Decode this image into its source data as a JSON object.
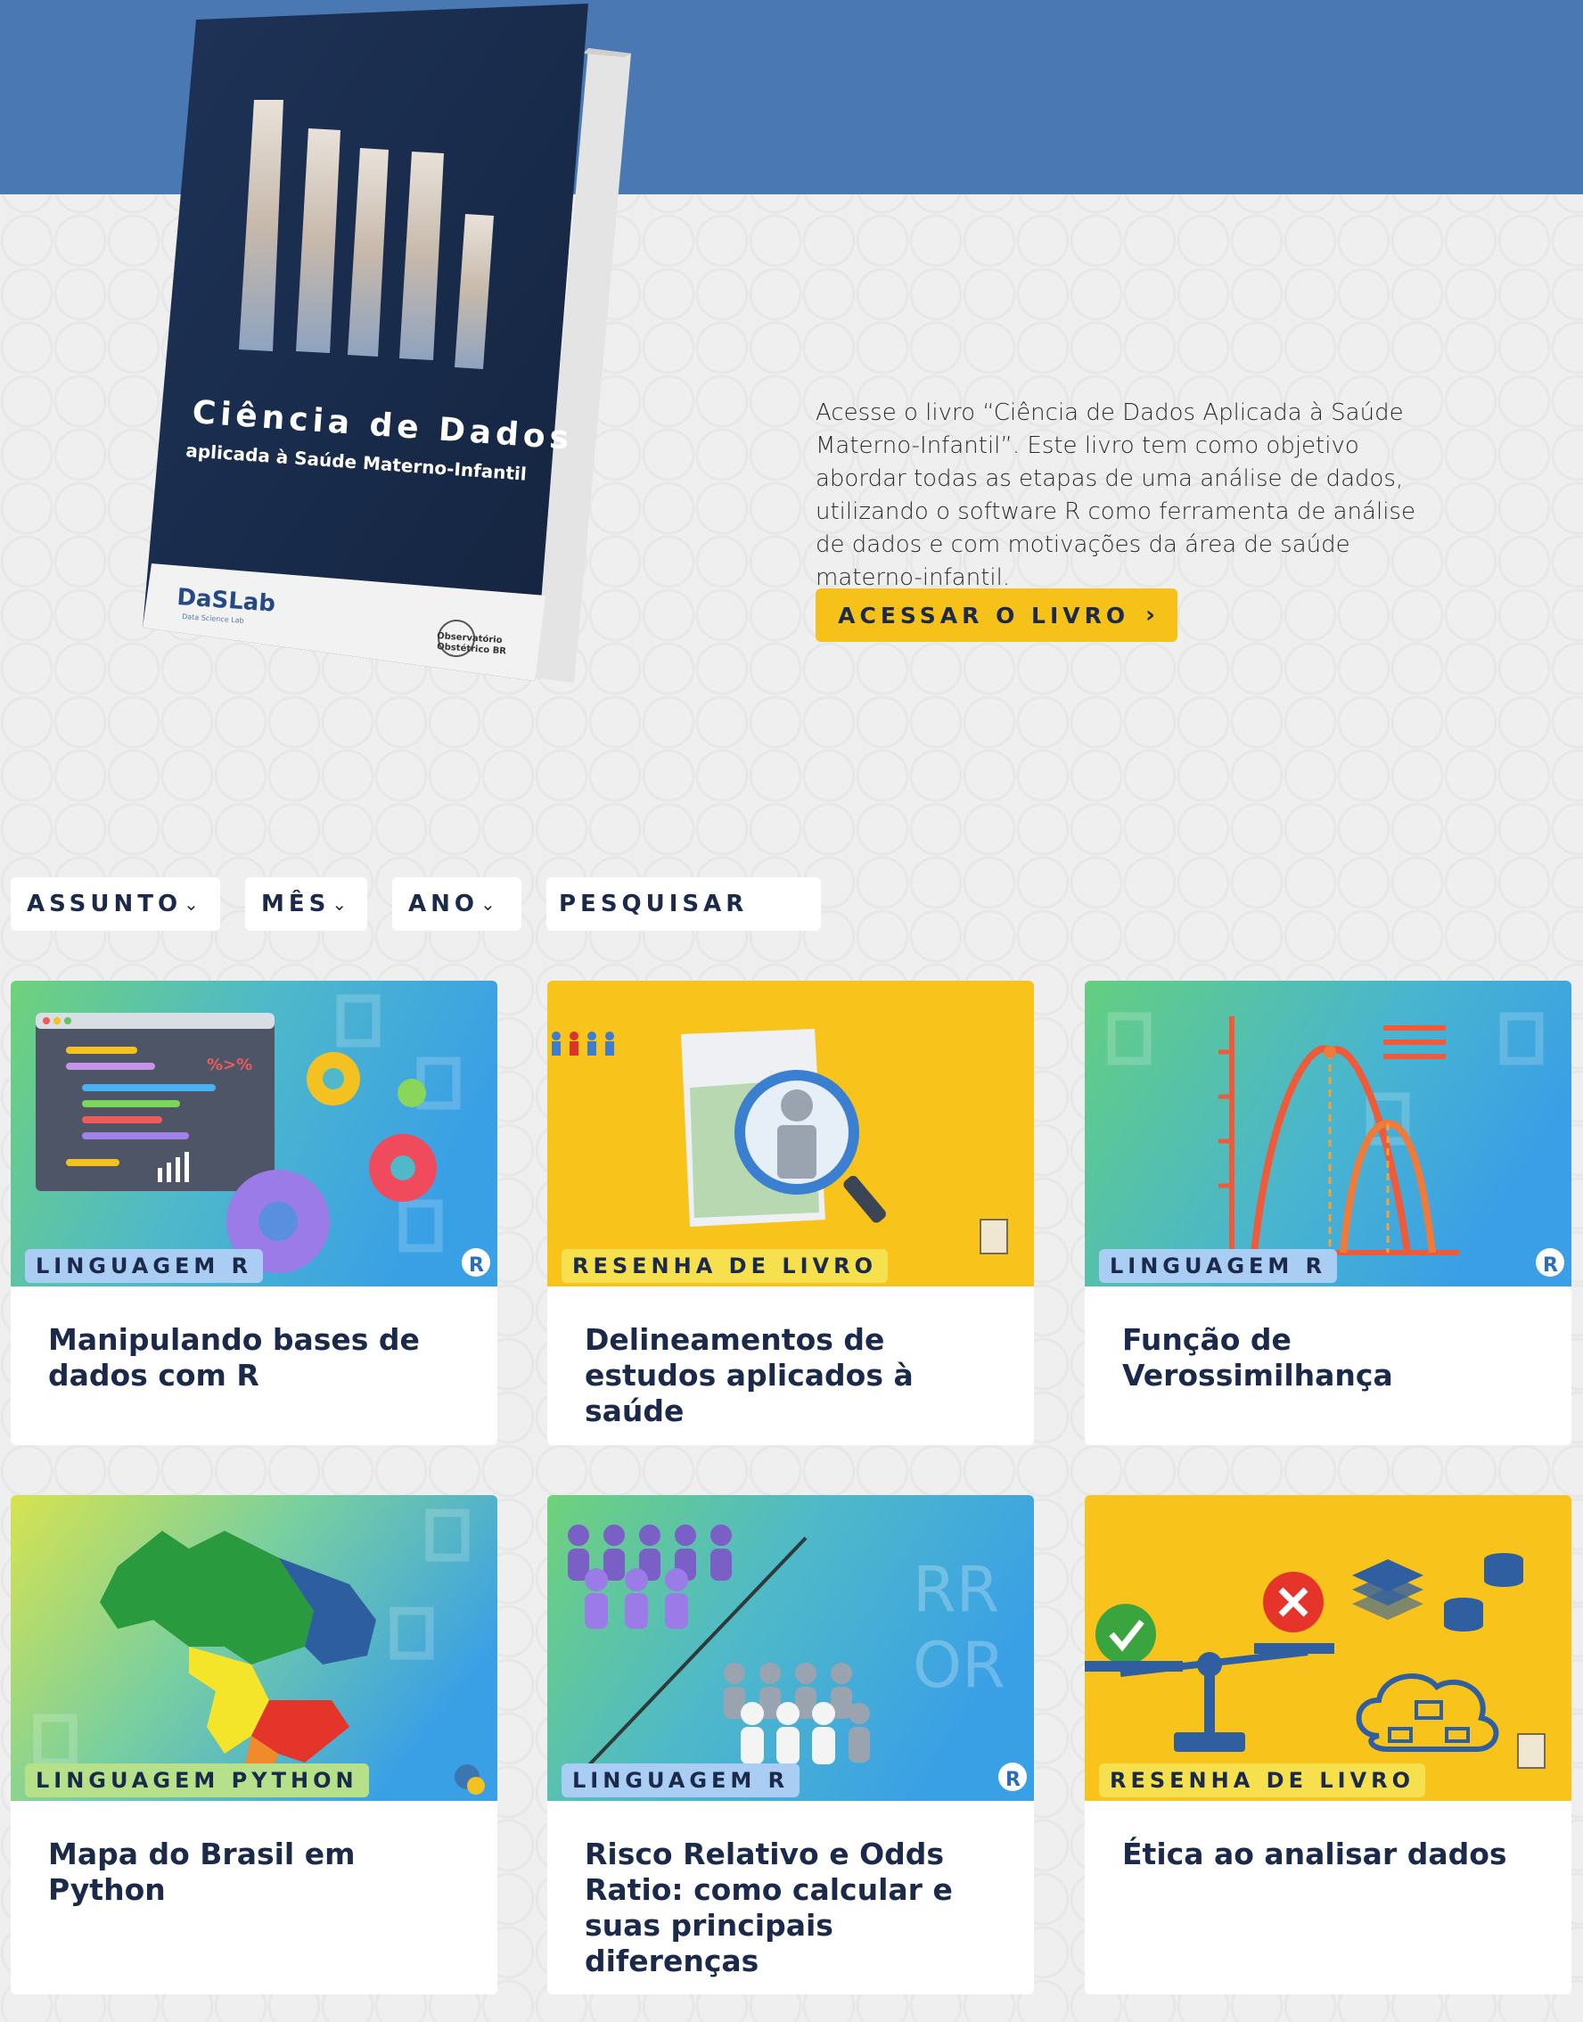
{
  "hero": {
    "book": {
      "title_line1": "Ciência de Dados",
      "title_line2": "aplicada à Saúde Materno-Infantil",
      "logo_left": "DaSLab",
      "logo_left_sub": "Data Science Lab",
      "logo_right_line1": "Observatório",
      "logo_right_line2": "Obstétrico BR"
    },
    "description": "Acesse o livro “Ciência de Dados Aplicada à Saúde Materno-Infantil”. Este livro tem como objetivo abordar todas as etapas de uma análise de dados, utilizando o software R como ferramenta de análise de dados e com motivações da área de saúde materno-infantil.",
    "cta_label": "ACESSAR O LIVRO",
    "cta_icon": "›"
  },
  "filters": {
    "subject": "ASSUNTO",
    "month": "MÊS",
    "year": "ANO",
    "search_placeholder": "PESQUISAR",
    "chevron": "⌄"
  },
  "thumb_text": {
    "percent_code": "%>%",
    "rr": "RR",
    "or": "OR",
    "r_logo": "R"
  },
  "cards": [
    {
      "tag": "LINGUAGEM R",
      "title": "Manipulando bases de dados com R"
    },
    {
      "tag": "RESENHA DE LIVRO",
      "title": "Delineamentos de estudos aplicados à saúde"
    },
    {
      "tag": "LINGUAGEM R",
      "title": "Função de Verossimilhança"
    },
    {
      "tag": "LINGUAGEM PYTHON",
      "title": "Mapa do Brasil em Python"
    },
    {
      "tag": "LINGUAGEM R",
      "title": "Risco Relativo e Odds Ratio: como calcular e suas principais diferenças"
    },
    {
      "tag": "RESENHA DE LIVRO",
      "title": "Ética ao analisar dados"
    }
  ],
  "colors": {
    "banner": "#4a78b2",
    "accent_yellow": "#f6c21a",
    "navy": "#1b2a4a"
  }
}
